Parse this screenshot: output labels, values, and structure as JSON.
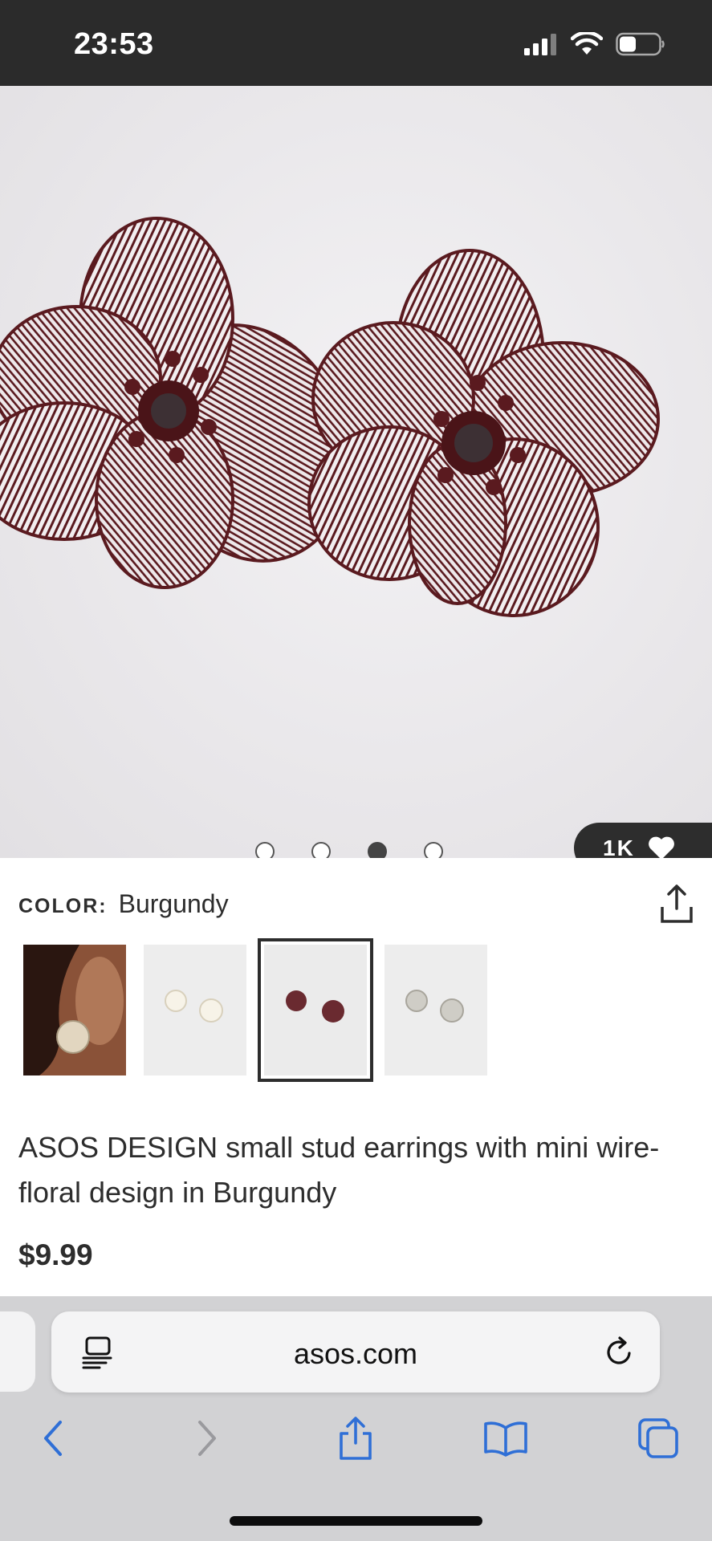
{
  "status_bar": {
    "time": "23:53"
  },
  "product": {
    "gallery": {
      "image_count": 4,
      "active_index": 2
    },
    "likes": "1K",
    "color_label": "COLOR:",
    "color_value": "Burgundy",
    "title": "ASOS DESIGN small stud earrings with mini wire-floral design in Burgundy",
    "price": "$9.99",
    "swatches": [
      {
        "name": "model-ear",
        "selected": false
      },
      {
        "name": "cream",
        "selected": false
      },
      {
        "name": "burgundy",
        "selected": true
      },
      {
        "name": "silver",
        "selected": false
      }
    ]
  },
  "browser": {
    "url": "asos.com",
    "icons": [
      "reader-icon",
      "reload-icon",
      "back-icon",
      "forward-icon",
      "share-icon",
      "bookmarks-icon",
      "tabs-icon"
    ]
  },
  "colors": {
    "accent": "#2f6fd6",
    "product": "#5a1a1f",
    "dark": "#2d2d2d"
  }
}
